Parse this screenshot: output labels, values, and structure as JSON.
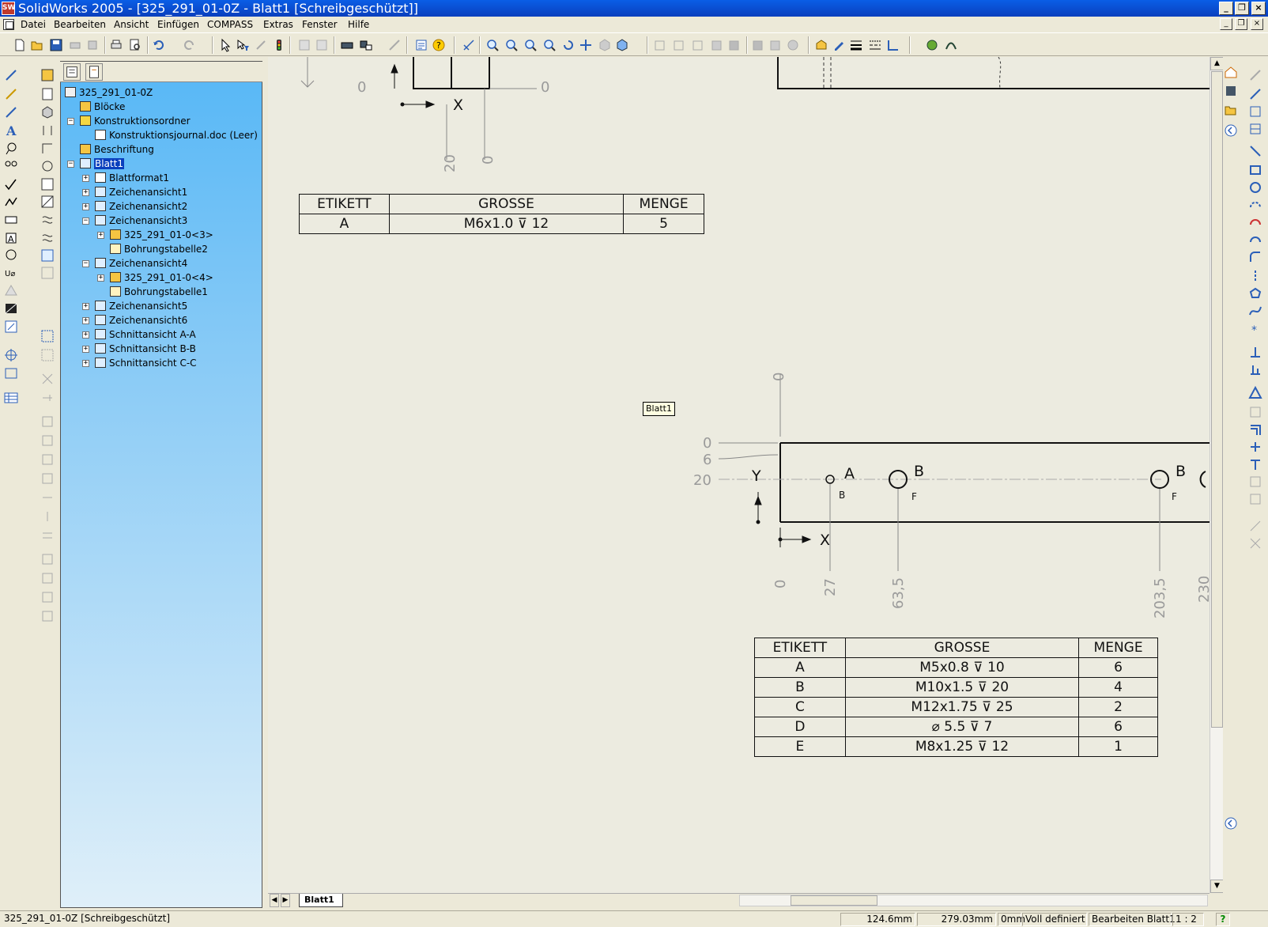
{
  "window": {
    "app_icon_text": "SW",
    "title": "SolidWorks 2005 - [325_291_01-0Z - Blatt1 [Schreibgeschützt]]",
    "minimize": "_",
    "restore": "❐",
    "close": "×"
  },
  "menu": {
    "items": [
      "Datei",
      "Bearbeiten",
      "Ansicht",
      "Einfügen",
      "COMPASS",
      "Extras",
      "Fenster",
      "Hilfe"
    ],
    "mdi_minimize": "_",
    "mdi_restore": "❐",
    "mdi_close": "×"
  },
  "tree": {
    "root": "325_291_01-0Z",
    "nodes": [
      {
        "label": "Blöcke",
        "level": 1,
        "expander": "",
        "icon": "blocks-icon"
      },
      {
        "label": "Konstruktionsordner",
        "level": 1,
        "expander": "−",
        "icon": "design-folder-icon"
      },
      {
        "label": "Konstruktionsjournal.doc (Leer)",
        "level": 2,
        "expander": "",
        "icon": "word-doc-icon"
      },
      {
        "label": "Beschriftung",
        "level": 1,
        "expander": "",
        "icon": "annotations-icon"
      },
      {
        "label": "Blatt1",
        "level": 1,
        "expander": "−",
        "icon": "sheet-icon",
        "selected": true
      },
      {
        "label": "Blattformat1",
        "level": 2,
        "expander": "+",
        "icon": "sheet-format-icon"
      },
      {
        "label": "Zeichenansicht1",
        "level": 2,
        "expander": "+",
        "icon": "drawing-view-icon"
      },
      {
        "label": "Zeichenansicht2",
        "level": 2,
        "expander": "+",
        "icon": "drawing-view-icon"
      },
      {
        "label": "Zeichenansicht3",
        "level": 2,
        "expander": "−",
        "icon": "drawing-view-icon"
      },
      {
        "label": "325_291_01-0<3>",
        "level": 3,
        "expander": "+",
        "icon": "part-icon"
      },
      {
        "label": "Bohrungstabelle2",
        "level": 3,
        "expander": "",
        "icon": "hole-table-icon"
      },
      {
        "label": "Zeichenansicht4",
        "level": 2,
        "expander": "−",
        "icon": "drawing-view-icon"
      },
      {
        "label": "325_291_01-0<4>",
        "level": 3,
        "expander": "+",
        "icon": "part-icon"
      },
      {
        "label": "Bohrungstabelle1",
        "level": 3,
        "expander": "",
        "icon": "hole-table-icon"
      },
      {
        "label": "Zeichenansicht5",
        "level": 2,
        "expander": "+",
        "icon": "drawing-view-icon"
      },
      {
        "label": "Zeichenansicht6",
        "level": 2,
        "expander": "+",
        "icon": "drawing-view-icon"
      },
      {
        "label": "Schnittansicht A-A",
        "level": 2,
        "expander": "+",
        "icon": "section-view-icon"
      },
      {
        "label": "Schnittansicht B-B",
        "level": 2,
        "expander": "+",
        "icon": "section-view-icon"
      },
      {
        "label": "Schnittansicht C-C",
        "level": 2,
        "expander": "+",
        "icon": "section-view-icon"
      }
    ]
  },
  "drawing": {
    "tooltip": "Blatt1",
    "top_view": {
      "dims": [
        "0",
        "0",
        "20",
        "0"
      ],
      "axis_x": "X"
    },
    "bottom_view": {
      "ordinate_y": [
        "0",
        "6",
        "20"
      ],
      "ordinate_x": [
        "0",
        "27",
        "63,5",
        "203,5",
        "230"
      ],
      "top_zero": "0",
      "axis_x": "X",
      "axis_y": "Y",
      "hole_tags": [
        {
          "tag": "A",
          "sub": "B"
        },
        {
          "tag": "B",
          "sub": "F"
        },
        {
          "tag": "B",
          "sub": "F"
        }
      ]
    },
    "table_small": {
      "headers": [
        "ETIKETT",
        "GROSSE",
        "MENGE"
      ],
      "rows": [
        [
          "A",
          "M6x1.0 ⊽ 12",
          "5"
        ]
      ]
    },
    "table_large": {
      "headers": [
        "ETIKETT",
        "GROSSE",
        "MENGE"
      ],
      "rows": [
        [
          "A",
          "M5x0.8 ⊽ 10",
          "6"
        ],
        [
          "B",
          "M10x1.5 ⊽ 20",
          "4"
        ],
        [
          "C",
          "M12x1.75 ⊽ 25",
          "2"
        ],
        [
          "D",
          "⌀ 5.5 ⊽ 7",
          "6"
        ],
        [
          "E",
          "M8x1.25 ⊽ 12",
          "1"
        ]
      ]
    }
  },
  "sheet_tab": "Blatt1",
  "status": {
    "file": "325_291_01-0Z [Schreibgeschützt]",
    "x": "124.6mm",
    "y": "279.03mm",
    "z": "0mm",
    "state": "Voll definiert",
    "mode": "Bearbeiten Blatt1",
    "scale": "1 : 2",
    "help": "?"
  },
  "colors": {
    "title_bar": "#0a4ed6",
    "tree_gradient_top": "#56b7f6",
    "tree_gradient_bottom": "#dfeff9",
    "sheet_background": "#ecebe0",
    "selection": "#0a3fbd"
  }
}
